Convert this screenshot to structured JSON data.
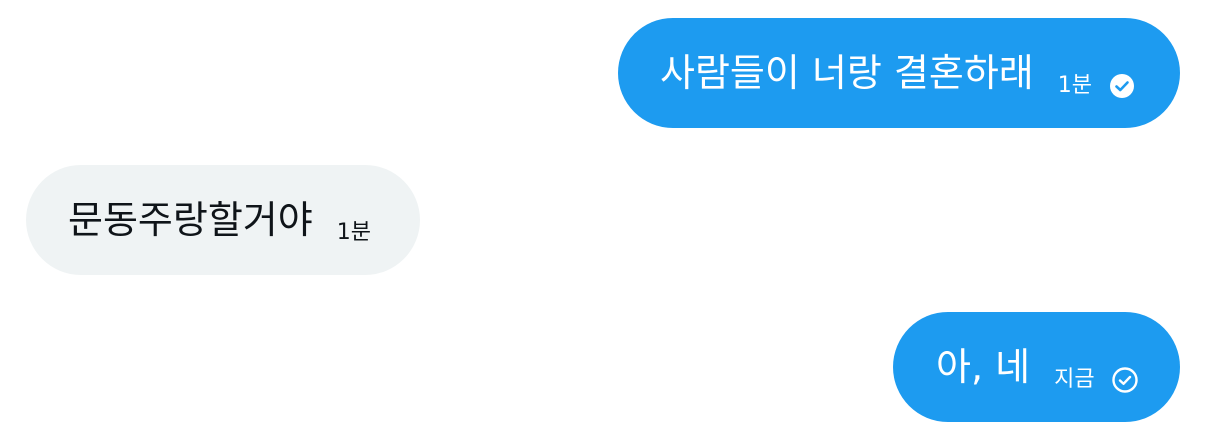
{
  "colors": {
    "sent_bubble": "#1d9bf0",
    "received_bubble": "#eff3f4",
    "sent_text": "#ffffff",
    "received_text": "#0f1419",
    "background": "#ffffff"
  },
  "messages": [
    {
      "direction": "sent",
      "text": "사람들이 너랑 결혼하래",
      "time": "1분",
      "status": "read",
      "status_icon": "check-circle-filled-icon"
    },
    {
      "direction": "received",
      "text": "문동주랑할거야",
      "time": "1분"
    },
    {
      "direction": "sent",
      "text": "아, 네",
      "time": "지금",
      "status": "sent",
      "status_icon": "check-circle-outline-icon"
    }
  ]
}
